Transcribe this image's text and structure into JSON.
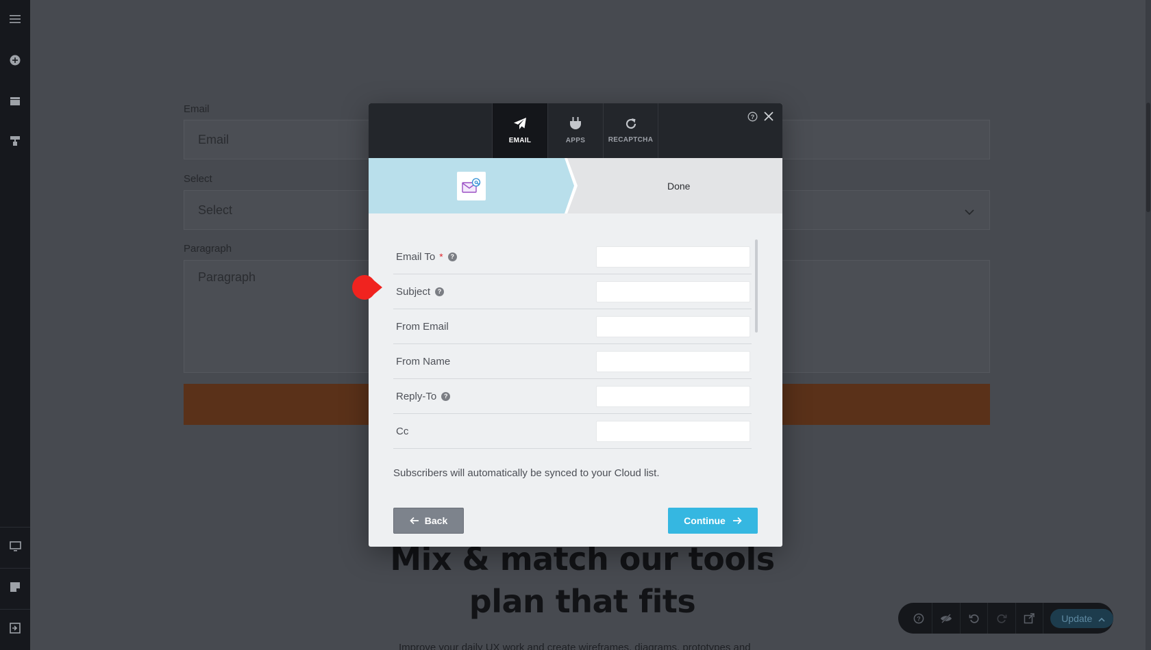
{
  "background_form": {
    "email_label": "Email",
    "email_placeholder": "Email",
    "select_label": "Select",
    "select_placeholder": "Select",
    "paragraph_label": "Paragraph",
    "paragraph_placeholder": "Paragraph",
    "heading_line1": "Mix & match our tools",
    "heading_line2": "plan that fits",
    "subtext": "Improve your daily UX work and create wireframes, diagrams, prototypes and"
  },
  "modal": {
    "tabs": [
      {
        "label": "EMAIL",
        "icon": "paper-plane-icon",
        "active": true
      },
      {
        "label": "APPS",
        "icon": "plug-icon",
        "active": false
      },
      {
        "label": "RECAPTCHA",
        "icon": "refresh-icon",
        "active": false
      }
    ],
    "steps": {
      "step1_icon": "email-at-icon",
      "step2_label": "Done"
    },
    "fields": [
      {
        "label": "Email To",
        "required": true,
        "help": true,
        "value": ""
      },
      {
        "label": "Subject",
        "required": false,
        "help": true,
        "value": ""
      },
      {
        "label": "From Email",
        "required": false,
        "help": false,
        "value": ""
      },
      {
        "label": "From Name",
        "required": false,
        "help": false,
        "value": ""
      },
      {
        "label": "Reply-To",
        "required": false,
        "help": true,
        "value": ""
      },
      {
        "label": "Cc",
        "required": false,
        "help": false,
        "value": ""
      }
    ],
    "required_mark": "*",
    "help_mark": "?",
    "note": "Subscribers will automatically be synced to your Cloud list.",
    "back_label": "Back",
    "continue_label": "Continue"
  },
  "toolbar": {
    "update_label": "Update"
  },
  "colors": {
    "accent": "#35b7e1",
    "step_active_bg": "#b9dfeb",
    "hotspot": "#f0231f",
    "required": "#e0262d"
  }
}
